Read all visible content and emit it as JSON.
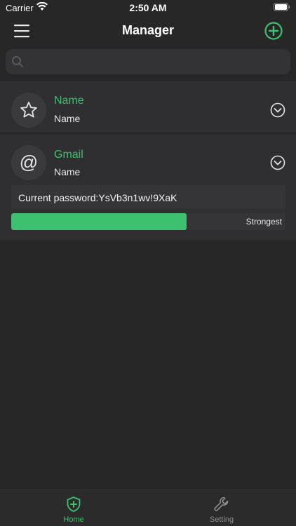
{
  "status_bar": {
    "carrier": "Carrier",
    "time": "2:50 AM"
  },
  "nav": {
    "title": "Manager"
  },
  "search": {
    "placeholder": "",
    "value": ""
  },
  "items": [
    {
      "title": "Name",
      "subtitle": "Name",
      "icon": "star-icon"
    },
    {
      "title": "Gmail",
      "subtitle": "Name",
      "icon": "at-sign-icon",
      "password_text": "Current password:YsVb3n1wv!9XaK",
      "strength_label": "Strongest",
      "strength_fraction": 0.64
    }
  ],
  "tabs": [
    {
      "label": "Home",
      "icon": "shield-plus-icon",
      "active": true
    },
    {
      "label": "Setting",
      "icon": "wrench-icon",
      "active": false
    }
  ],
  "colors": {
    "accent": "#3ec16e",
    "background": "#272728",
    "card": "#2f2f31"
  }
}
